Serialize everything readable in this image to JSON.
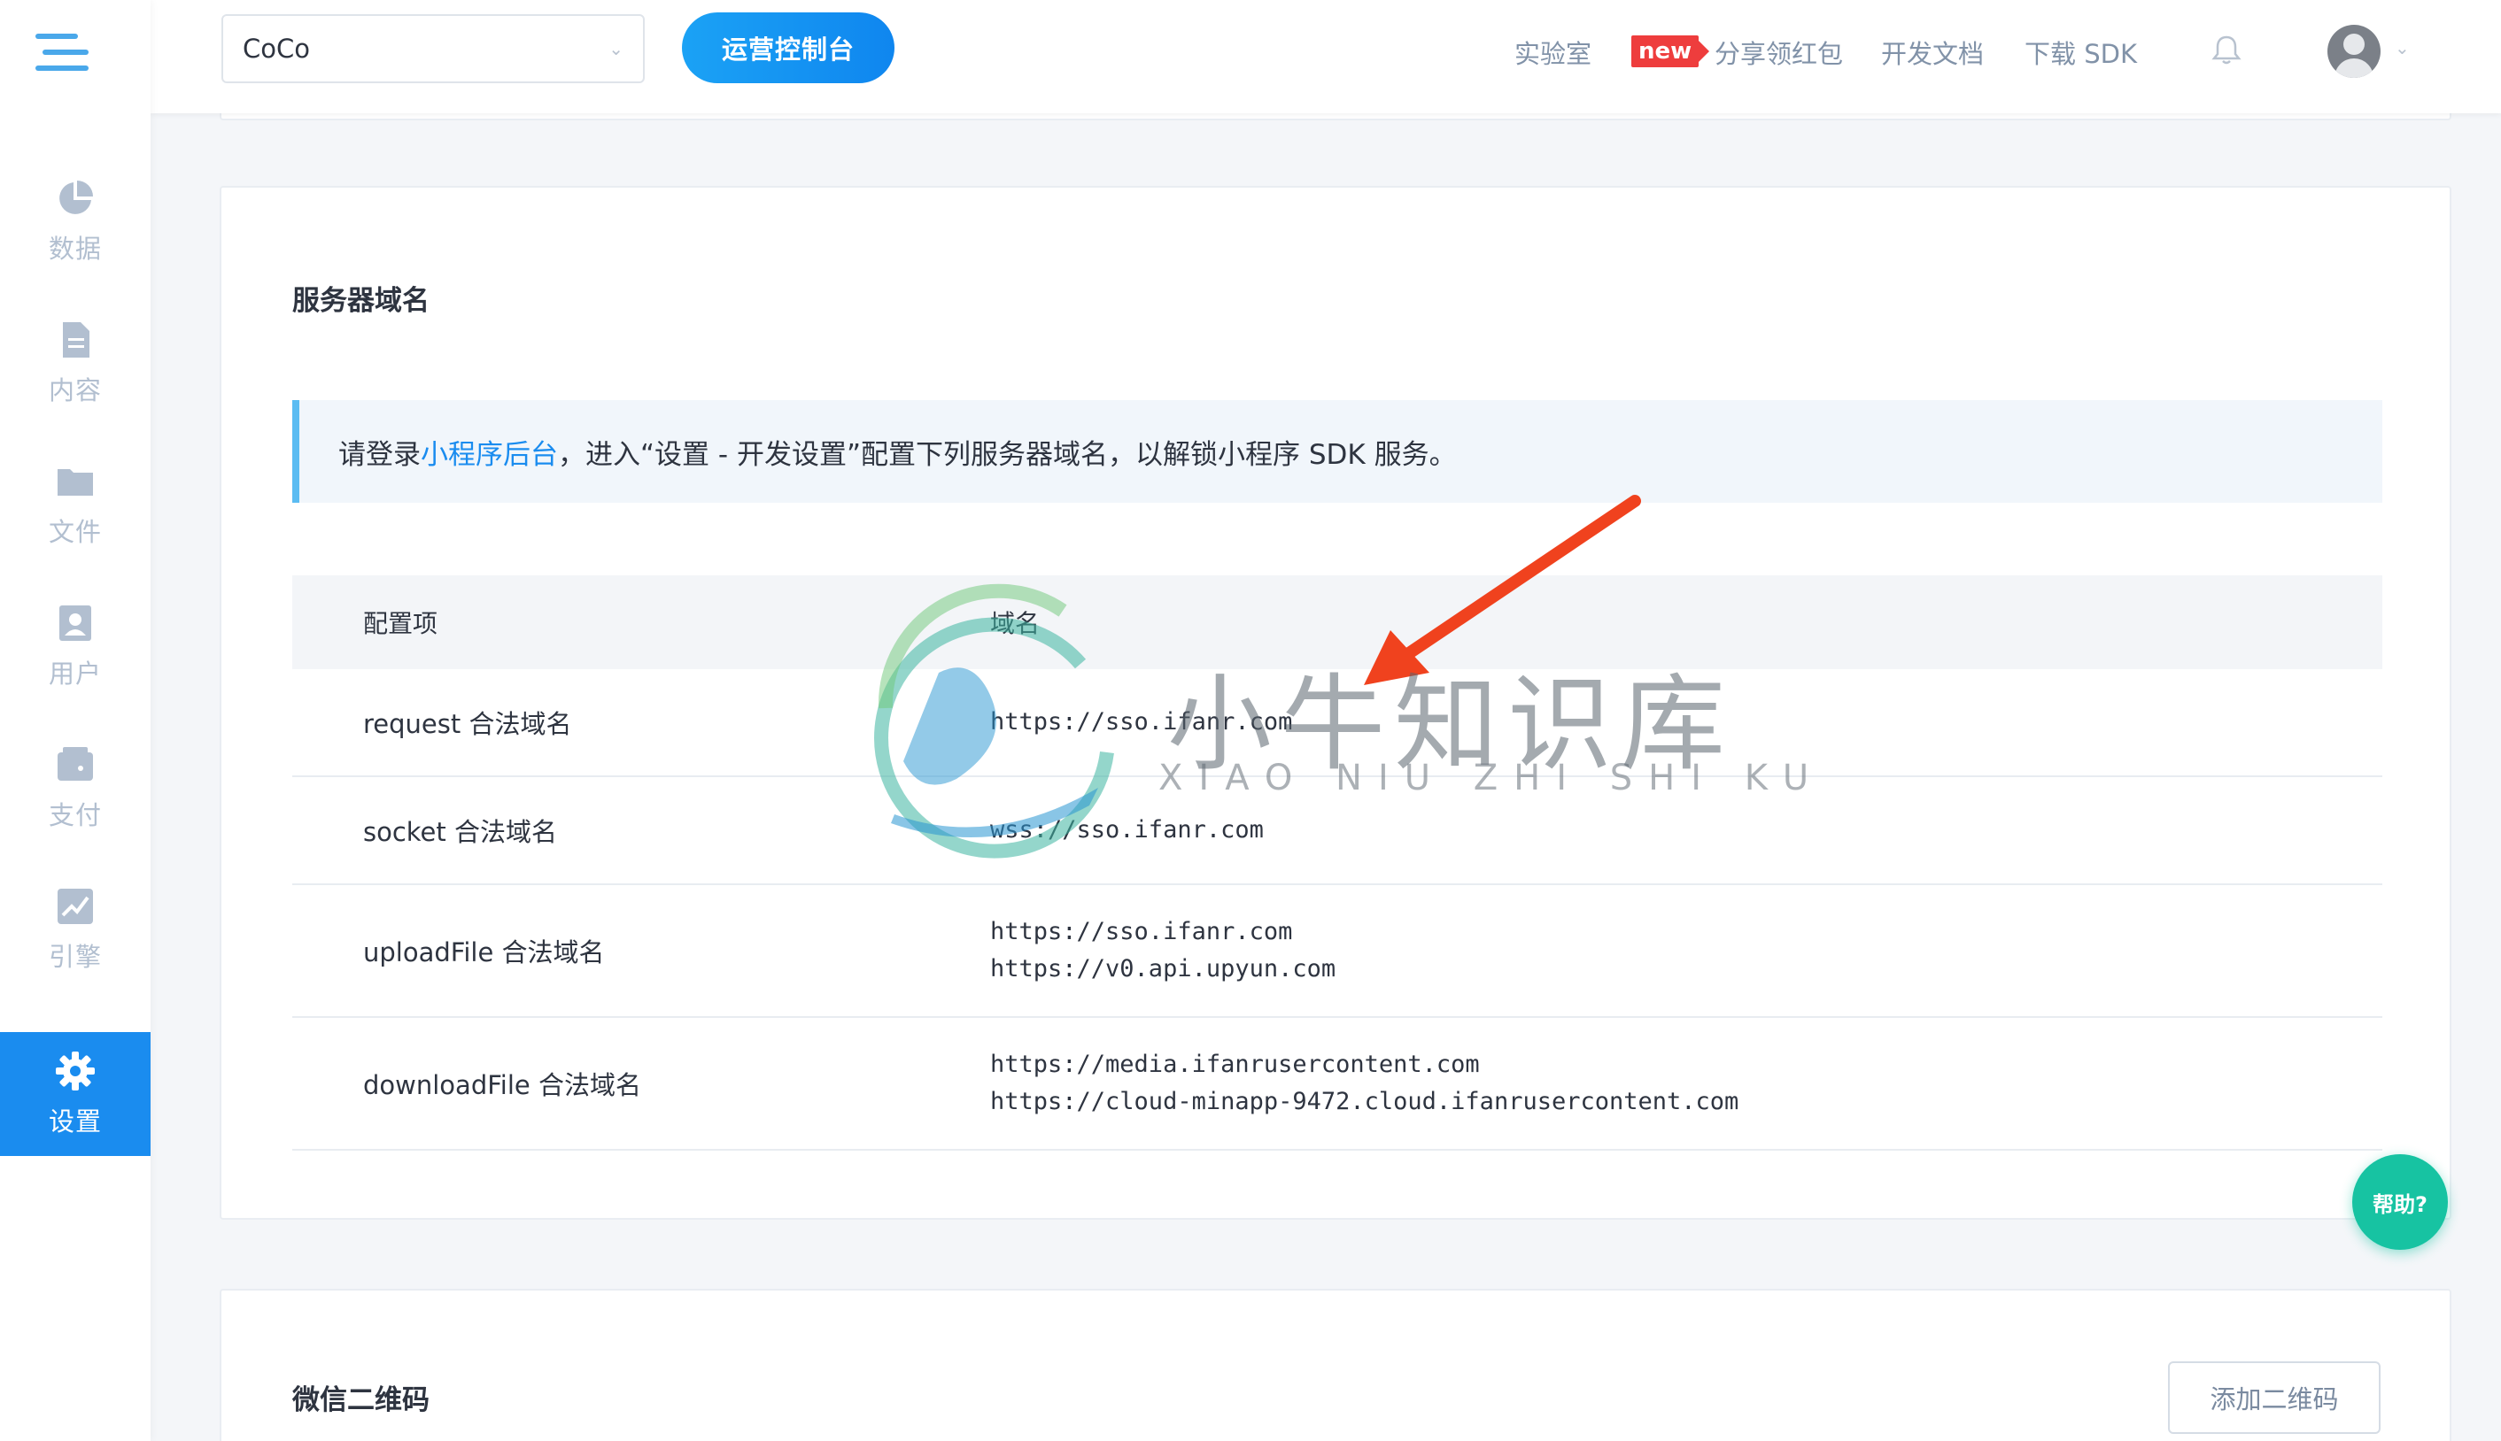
{
  "sidebar": {
    "items": [
      {
        "label": "数据",
        "icon": "pie-chart-icon"
      },
      {
        "label": "内容",
        "icon": "document-icon"
      },
      {
        "label": "文件",
        "icon": "folder-icon"
      },
      {
        "label": "用户",
        "icon": "user-card-icon"
      },
      {
        "label": "支付",
        "icon": "wallet-icon"
      },
      {
        "label": "引擎",
        "icon": "trend-icon"
      },
      {
        "label": "设置",
        "icon": "gear-icon",
        "active": true
      }
    ],
    "accent": "#1a8cef"
  },
  "topbar": {
    "app_select_value": "CoCo",
    "console_button": "运营控制台",
    "links": {
      "lab": "实验室",
      "new_badge": "new",
      "share": "分享领红包",
      "docs": "开发文档",
      "sdk": "下载 SDK"
    }
  },
  "server_domain": {
    "title": "服务器域名",
    "notice_prefix": "请登录",
    "notice_link": "小程序后台",
    "notice_suffix": "，进入“设置 - 开发设置”配置下列服务器域名，以解锁小程序 SDK 服务。",
    "columns": [
      "配置项",
      "域名"
    ],
    "rows": [
      {
        "item": "request 合法域名",
        "domains": [
          "https://sso.ifanr.com"
        ]
      },
      {
        "item": "socket 合法域名",
        "domains": [
          "wss://sso.ifanr.com"
        ]
      },
      {
        "item": "uploadFile 合法域名",
        "domains": [
          "https://sso.ifanr.com",
          "https://v0.api.upyun.com"
        ]
      },
      {
        "item": "downloadFile 合法域名",
        "domains": [
          "https://media.ifanrusercontent.com",
          "https://cloud-minapp-9472.cloud.ifanrusercontent.com"
        ]
      }
    ]
  },
  "wechat_qr": {
    "title": "微信二维码",
    "add_button": "添加二维码"
  },
  "help_button": "帮助?",
  "watermark": {
    "text": "小牛知识库",
    "sub": "XIAO NIU ZHI SHI KU"
  }
}
